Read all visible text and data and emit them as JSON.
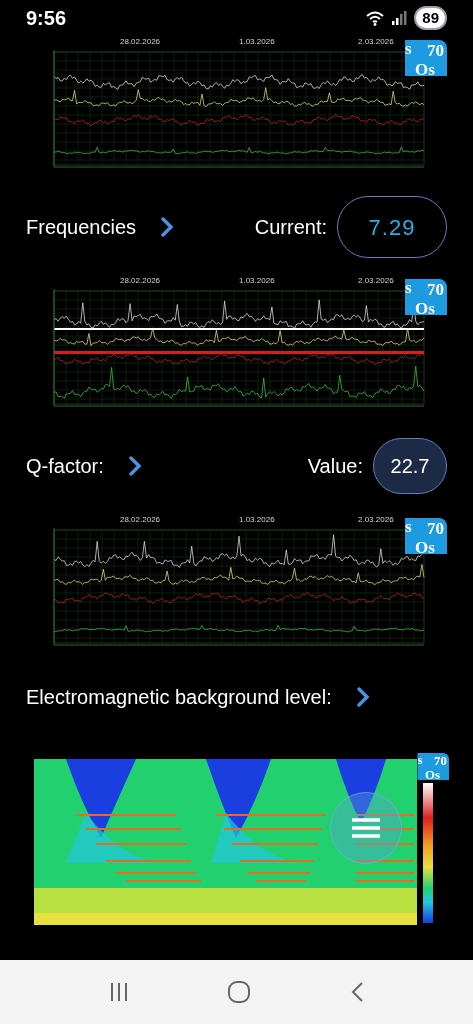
{
  "status_bar": {
    "time": "9:56",
    "battery": "89"
  },
  "blocks": [
    {
      "kind": "line_chart",
      "dates": [
        "28.02.2026",
        "1.03.2026",
        "2.03.2026"
      ],
      "logo": {
        "first": "s",
        "number": "70",
        "last": "Os"
      }
    },
    {
      "kind": "link_row",
      "label": "Frequencies",
      "reading": {
        "kind": "outlined",
        "label": "Current:",
        "value": "7.29"
      }
    },
    {
      "kind": "line_chart",
      "dates": [
        "28.02.2026",
        "1.03.2026",
        "2.03.2026"
      ],
      "logo": {
        "first": "s",
        "number": "70",
        "last": "Os"
      }
    },
    {
      "kind": "link_row",
      "label": "Q-factor:",
      "reading": {
        "kind": "filled",
        "label": "Value:",
        "value": "22.7"
      }
    },
    {
      "kind": "line_chart",
      "dates": [
        "28.02.2026",
        "1.03.2026",
        "2.03.2026"
      ],
      "logo": {
        "first": "s",
        "number": "70",
        "last": "Os"
      }
    },
    {
      "kind": "link_row",
      "label": "Electromagnetic background level:"
    },
    {
      "kind": "spectrogram",
      "logo": {
        "first": "s",
        "number": "70",
        "last": "Os"
      }
    }
  ]
}
